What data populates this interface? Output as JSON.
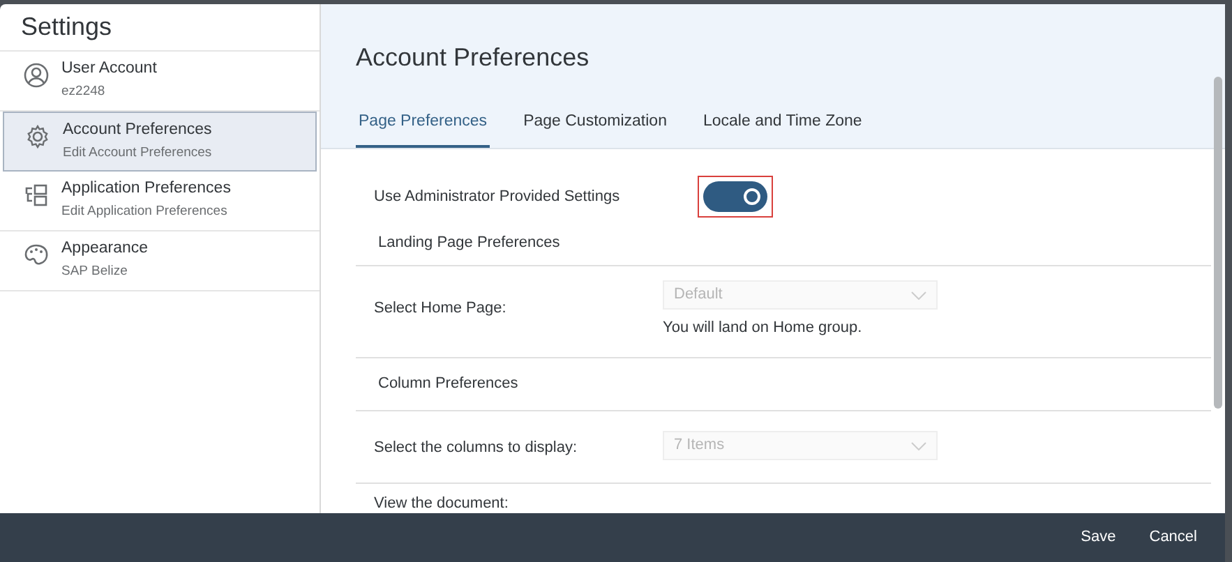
{
  "sidebar": {
    "title": "Settings",
    "items": [
      {
        "kind": "user",
        "label": "User Account",
        "sublabel": "ez2248",
        "selected": false
      },
      {
        "kind": "gear",
        "label": "Account Preferences",
        "sublabel": "Edit Account Preferences",
        "selected": true
      },
      {
        "kind": "apps",
        "label": "Application Preferences",
        "sublabel": "Edit Application Preferences",
        "selected": false
      },
      {
        "kind": "palette",
        "label": "Appearance",
        "sublabel": "SAP Belize",
        "selected": false
      }
    ]
  },
  "header": {
    "title": "Account Preferences"
  },
  "tabs": [
    {
      "label": "Page Preferences",
      "selected": true
    },
    {
      "label": "Page Customization",
      "selected": false
    },
    {
      "label": "Locale and Time Zone",
      "selected": false
    }
  ],
  "content": [
    {
      "kind": "toggle",
      "label": "Use Administrator Provided Settings",
      "on": true,
      "highlighted": true
    },
    {
      "kind": "section",
      "label": "Landing Page Preferences"
    },
    {
      "kind": "select",
      "label": "Select Home Page:",
      "value": "Default",
      "disabled": true,
      "note": "You will land on Home group."
    },
    {
      "kind": "section",
      "label": "Column Preferences"
    },
    {
      "kind": "select",
      "label": "Select the columns to display:",
      "value": "7 Items",
      "disabled": true
    },
    {
      "kind": "text",
      "label": "View the document:"
    }
  ],
  "footer": {
    "buttons": [
      "Save",
      "Cancel"
    ]
  }
}
